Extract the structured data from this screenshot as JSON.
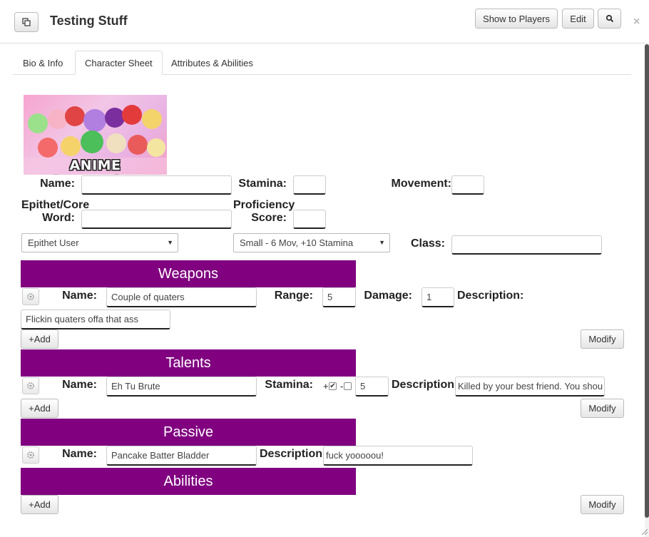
{
  "header": {
    "title": "Testing Stuff",
    "buttons": {
      "show_to_players": "Show to Players",
      "edit": "Edit"
    },
    "close": "×"
  },
  "tabs": [
    {
      "label": "Bio & Info"
    },
    {
      "label": "Character Sheet"
    },
    {
      "label": "Attributes & Abilities"
    }
  ],
  "character": {
    "image_caption": "ANIME CAMPAIGN!",
    "labels": {
      "name": "Name:",
      "stamina": "Stamina:",
      "movement": "Movement:",
      "epithet_line1": "Epithet/Core",
      "epithet_line2": "Word:",
      "proficiency_line1": "Proficiency",
      "proficiency_line2": "Score:",
      "class": "Class:"
    },
    "values": {
      "name": "",
      "stamina": "",
      "movement": "",
      "epithet": "",
      "proficiency": "",
      "class": ""
    },
    "epithet_select": "Epithet User",
    "size_select": "Small - 6 Mov, +10 Stamina"
  },
  "weapons": {
    "heading": "Weapons",
    "labels": {
      "name": "Name:",
      "range": "Range:",
      "damage": "Damage:",
      "description": "Description:"
    },
    "item": {
      "name": "Couple of quaters",
      "range": "5",
      "damage": "1",
      "description": "Flickin quaters offa that ass"
    },
    "add_label": "+Add",
    "modify_label": "Modify"
  },
  "talents": {
    "heading": "Talents",
    "labels": {
      "name": "Name:",
      "stamina": "Stamina:",
      "plus": "+",
      "minus": "-",
      "description": "Description:"
    },
    "item": {
      "name": "Eh Tu Brute",
      "stamina": "5",
      "description": "Killed by your best friend. You shou",
      "plus_checked": true,
      "minus_checked": false
    },
    "add_label": "+Add",
    "modify_label": "Modify"
  },
  "passive": {
    "heading": "Passive",
    "labels": {
      "name": "Name:",
      "description": "Description:"
    },
    "item": {
      "name": "Pancake Batter Bladder",
      "description": "fuck yooooou!"
    }
  },
  "abilities": {
    "heading": "Abilities",
    "add_label": "+Add",
    "modify_label": "Modify"
  },
  "colors": {
    "banner": "#800080",
    "accent": "#800080"
  }
}
